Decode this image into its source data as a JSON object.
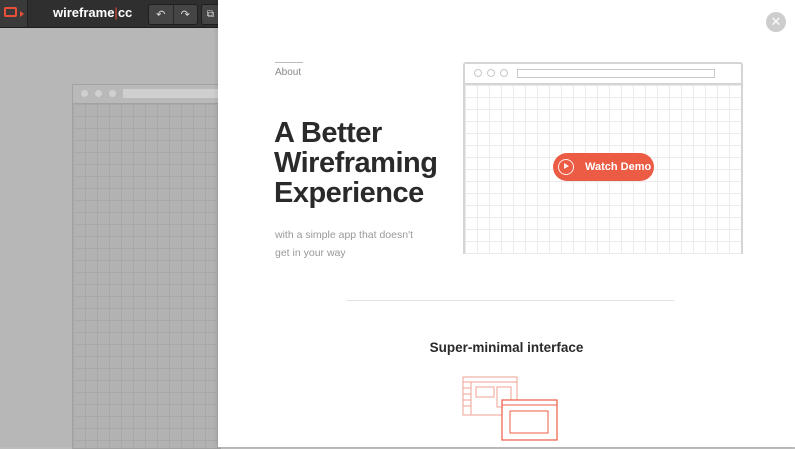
{
  "app": {
    "brand_left": "wireframe",
    "brand_sep": "|",
    "brand_right": "cc",
    "toolbar": {
      "undo_glyph": "↶",
      "redo_glyph": "↷",
      "copy_glyph": "⧉"
    }
  },
  "modal": {
    "close_glyph": "✕",
    "about_label": "About",
    "headline": "A Better Wireframing Experience",
    "subhead": "with a simple app that doesn't get in your way",
    "watch_demo_label": "Watch Demo",
    "feature_title": "Super-minimal interface"
  },
  "icons": {
    "logo": "window-frame-icon",
    "undo": "undo-icon",
    "redo": "redo-icon",
    "copy": "copy-icon",
    "close": "close-icon",
    "play": "play-icon",
    "feature": "minimal-interface-icon"
  },
  "colors": {
    "accent": "#ec5b44",
    "toolbar_bg": "#2f2f2f",
    "backdrop": "#b7b7b7",
    "heading": "#2a2a2a",
    "muted_text": "#999999"
  }
}
